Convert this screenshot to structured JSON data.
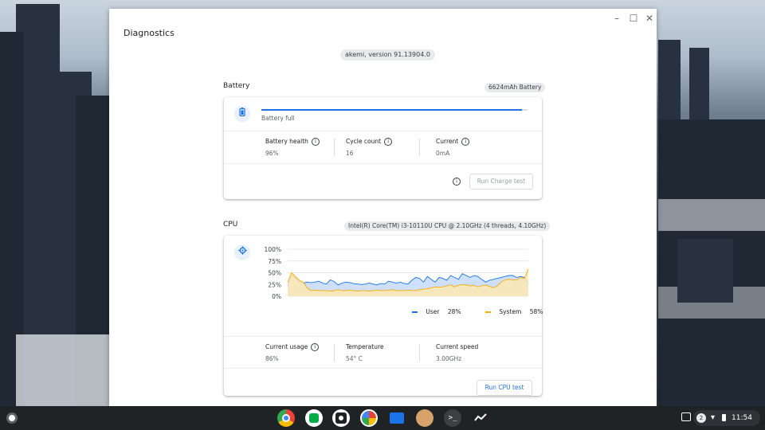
{
  "app": {
    "title": "Diagnostics",
    "version": "akemi, version 91.13904.0"
  },
  "battery": {
    "title": "Battery",
    "badge": "6624mAh Battery",
    "status": "Battery full",
    "charge_fraction": 0.98,
    "metrics": [
      {
        "label": "Battery health",
        "value": "96%"
      },
      {
        "label": "Cycle count",
        "value": "16"
      },
      {
        "label": "Current",
        "value": "0mA"
      }
    ],
    "run_button": "Run Charge test",
    "icon": "battery-icon"
  },
  "cpu": {
    "title": "CPU",
    "badge": "Intel(R) Core(TM) i3-10110U CPU @ 2.10GHz (4 threads, 4.10GHz)",
    "icon": "gear-icon",
    "metrics": [
      {
        "label": "Current usage",
        "value": "86%"
      },
      {
        "label": "Temperature",
        "value": "54° C"
      },
      {
        "label": "Current speed",
        "value": "3.00GHz"
      }
    ],
    "run_button": "Run CPU test",
    "legend": [
      {
        "name": "User",
        "value": "28%",
        "color": "#1a73e8"
      },
      {
        "name": "System",
        "value": "58%",
        "color": "#f9ab00"
      }
    ]
  },
  "chart_data": {
    "type": "area",
    "y_tick_labels": [
      "100%",
      "75%",
      "50%",
      "25%",
      "0%"
    ],
    "ylim": [
      0,
      100
    ],
    "series": [
      {
        "name": "User",
        "values": [
          22,
          44,
          40,
          30,
          28,
          30,
          29,
          30,
          32,
          28,
          26,
          35,
          31,
          24,
          28,
          30,
          29,
          27,
          26,
          25,
          26,
          28,
          26,
          24,
          27,
          26,
          32,
          30,
          28,
          30,
          27,
          26,
          34,
          40,
          38,
          30,
          42,
          36,
          30,
          40,
          38,
          34,
          44,
          40,
          36,
          48,
          44,
          40,
          44,
          42,
          36,
          30,
          34,
          36,
          38,
          40,
          42,
          44,
          44,
          40,
          42,
          40,
          28
        ]
      },
      {
        "name": "System",
        "values": [
          30,
          50,
          42,
          34,
          30,
          18,
          12,
          13,
          12,
          12,
          12,
          11,
          12,
          14,
          12,
          12,
          13,
          12,
          11,
          12,
          12,
          11,
          12,
          13,
          12,
          12,
          13,
          14,
          12,
          12,
          12,
          13,
          12,
          12,
          14,
          15,
          16,
          18,
          20,
          19,
          20,
          22,
          24,
          20,
          23,
          25,
          24,
          22,
          23,
          20,
          22,
          24,
          21,
          18,
          22,
          30,
          35,
          36,
          35,
          34,
          40,
          38,
          58
        ]
      }
    ]
  },
  "shelf": {
    "apps": [
      "chrome-icon",
      "hangouts-icon",
      "camera-icon",
      "photos-icon",
      "files-icon",
      "app-icon",
      "terminal-icon",
      "diagnostics-icon"
    ],
    "notification_count": "2",
    "time": "11:54"
  },
  "colors": {
    "accent": "#1a73e8",
    "system": "#f9ab00",
    "shelf": "#1f2326"
  }
}
